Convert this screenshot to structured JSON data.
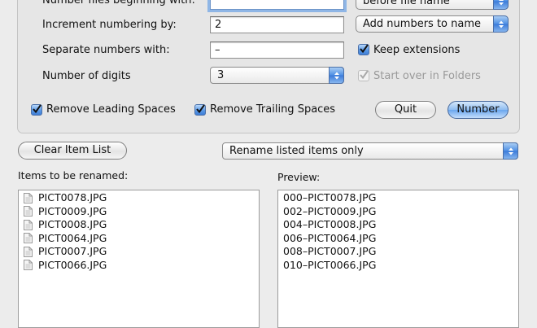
{
  "options": {
    "begin_label": "Number files beginning with:",
    "begin_value": "",
    "increment_label": "Increment numbering by:",
    "increment_value": "2",
    "separate_label": "Separate numbers with:",
    "separate_value": "–",
    "digits_label": "Number of digits",
    "digits_value": "3",
    "position_value": "before file name",
    "add_value": "Add numbers to name",
    "keep_extensions_label": "Keep extensions",
    "keep_extensions_checked": true,
    "start_over_label": "Start over in Folders",
    "start_over_checked": true,
    "remove_leading_label": "Remove Leading Spaces",
    "remove_leading_checked": true,
    "remove_trailing_label": "Remove Trailing Spaces",
    "remove_trailing_checked": true
  },
  "buttons": {
    "quit": "Quit",
    "number": "Number",
    "clear": "Clear Item List"
  },
  "scope_value": "Rename listed items only",
  "items_label": "Items to be renamed:",
  "preview_label": "Preview:",
  "items": [
    "PICT0078.JPG",
    "PICT0009.JPG",
    "PICT0008.JPG",
    "PICT0064.JPG",
    "PICT0007.JPG",
    "PICT0066.JPG"
  ],
  "preview": [
    "000–PICT0078.JPG",
    "002–PICT0009.JPG",
    "004–PICT0008.JPG",
    "006–PICT0064.JPG",
    "008–PICT0007.JPG",
    "010–PICT0066.JPG"
  ],
  "colors": {
    "accent": "#3f7ed6",
    "focus_ring": "#8fb6e6"
  }
}
